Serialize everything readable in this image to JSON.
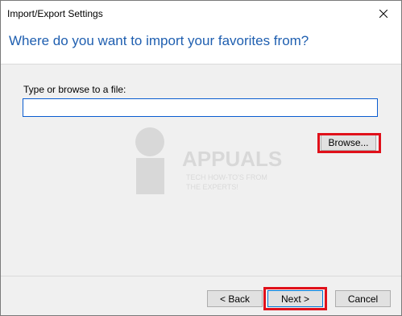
{
  "window": {
    "title": "Import/Export Settings"
  },
  "header": {
    "heading": "Where do you want to import your favorites from?"
  },
  "form": {
    "label": "Type or browse to a file:",
    "file_value": "",
    "browse_label": "Browse..."
  },
  "footer": {
    "back_label": "< Back",
    "next_label": "Next >",
    "cancel_label": "Cancel"
  },
  "watermark": {
    "brand": "APPUALS",
    "tagline_1": "TECH HOW-TO'S FROM",
    "tagline_2": "THE EXPERTS!"
  },
  "colors": {
    "heading": "#1f5fb0",
    "highlight": "#e0101a",
    "focus_border": "#0a5cd0"
  }
}
